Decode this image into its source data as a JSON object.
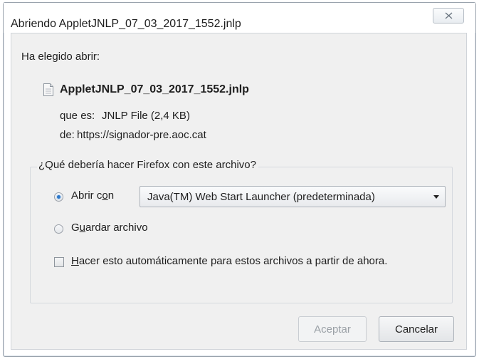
{
  "window": {
    "title": "Abriendo AppletJNLP_07_03_2017_1552.jnlp"
  },
  "dialog": {
    "heading": "Ha elegido abrir:",
    "file_name": "AppletJNLP_07_03_2017_1552.jnlp",
    "type_label": "que es:",
    "type_value": "JNLP File (2,4 KB)",
    "from_label": "de:",
    "from_value": "https://signador-pre.aoc.cat"
  },
  "action_group": {
    "legend": "¿Qué debería hacer Firefox con este archivo?",
    "open_with": {
      "label_pre": "Abrir c",
      "label_key": "o",
      "label_post": "n",
      "selected": true
    },
    "application_select": {
      "value": "Java(TM) Web Start Launcher (predeterminada)"
    },
    "save_file": {
      "label_pre": "G",
      "label_key": "u",
      "label_post": "ardar archivo",
      "selected": false
    },
    "auto_checkbox": {
      "label_key": "H",
      "label_post": "acer esto automáticamente para estos archivos a partir de ahora.",
      "checked": false
    }
  },
  "buttons": {
    "accept": "Aceptar",
    "accept_enabled": false,
    "cancel": "Cancelar"
  },
  "icons": {
    "close": "close-icon",
    "file": "file-icon",
    "dropdown": "chevron-down-icon"
  }
}
